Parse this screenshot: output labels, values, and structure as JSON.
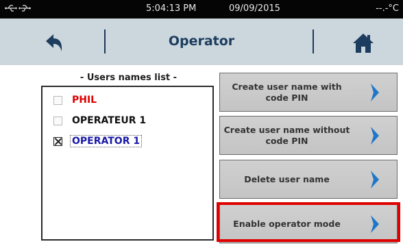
{
  "statusbar": {
    "usb_icons": [
      "usb-icon",
      "usb-icon"
    ],
    "time": "5:04:13 PM",
    "date": "09/09/2015",
    "temperature": "--.-°C"
  },
  "header": {
    "title": "Operator",
    "back_icon": "back-arrow-icon",
    "home_icon": "home-icon"
  },
  "users": {
    "title": "- Users names list -",
    "items": [
      {
        "name": "PHIL",
        "checked": false,
        "color": "#e00000"
      },
      {
        "name": "OPERATEUR 1",
        "checked": false,
        "color": "#111111"
      },
      {
        "name": "OPERATOR 1",
        "checked": true,
        "color": "#1a1aa8"
      }
    ]
  },
  "actions": [
    {
      "label": "Create user name with code PIN",
      "icon": "chevron-right-icon"
    },
    {
      "label": "Create user name without code PIN",
      "icon": "chevron-right-icon"
    },
    {
      "label": "Delete user name",
      "icon": "chevron-right-icon"
    },
    {
      "label": "Enable operator mode",
      "icon": "chevron-right-icon",
      "highlighted": true
    }
  ],
  "colors": {
    "highlight": "#e00000",
    "chevron": "#1f77c9",
    "header_bg": "#ccd6dd",
    "title": "#1d3d5f"
  }
}
